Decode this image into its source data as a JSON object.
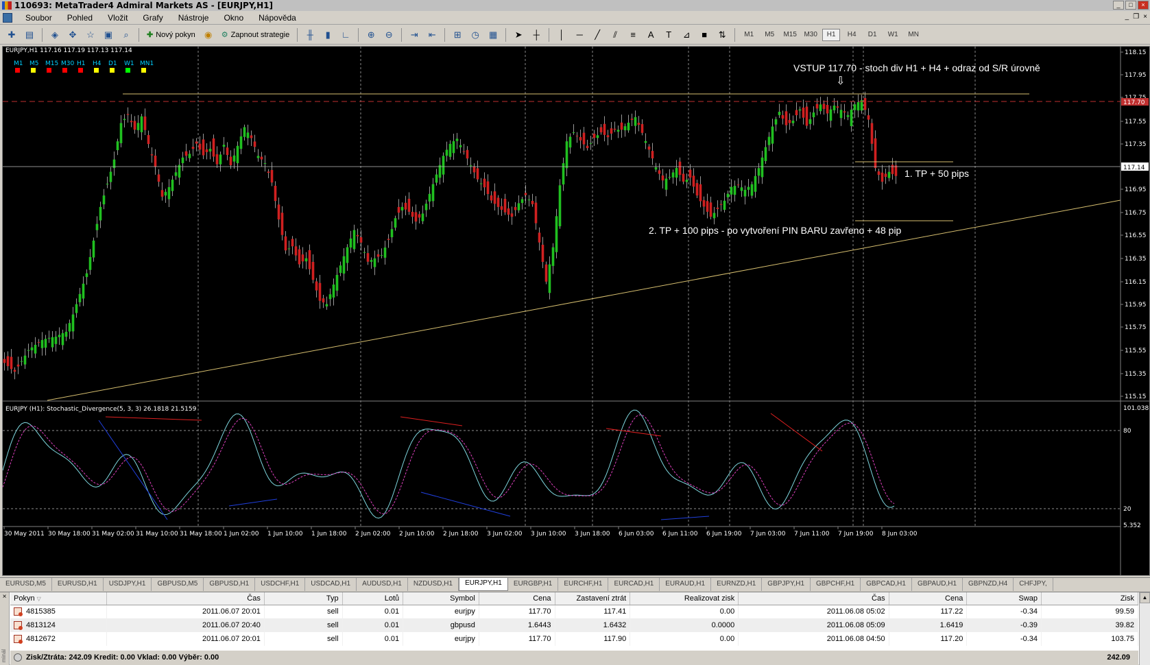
{
  "window": {
    "title": "110693: MetaTrader4 Admiral Markets AS - [EURJPY,H1]"
  },
  "menu": [
    "Soubor",
    "Pohled",
    "Vložit",
    "Grafy",
    "Nástroje",
    "Okno",
    "Nápověda"
  ],
  "toolbar": {
    "new_order_label": "Nový pokyn",
    "strategy_label": "Zapnout strategie",
    "timeframes": [
      "M1",
      "M5",
      "M15",
      "M30",
      "H1",
      "H4",
      "D1",
      "W1",
      "MN"
    ],
    "active_timeframe": "H1"
  },
  "chart": {
    "header": "EURJPY,H1  117.16 117.19 117.13 117.14",
    "mtf_labels": [
      "M1",
      "M5",
      "M15",
      "M30",
      "H1",
      "H4",
      "D1",
      "W1",
      "MN1"
    ],
    "mtf_colors": [
      "#ff0000",
      "#ffff00",
      "#ff0000",
      "#ff0000",
      "#ff0000",
      "#ffff00",
      "#ffff00",
      "#00ff00",
      "#ffff00"
    ],
    "price_labels": [
      "118.15",
      "117.95",
      "117.75",
      "117.70",
      "117.55",
      "117.35",
      "117.14",
      "116.95",
      "116.75",
      "116.55",
      "116.35",
      "116.15",
      "115.95",
      "115.75",
      "115.55",
      "115.35",
      "115.15"
    ],
    "current_price": "117.14",
    "entry_price": "117.70",
    "annotations": {
      "entry": "VSTUP 117.70 - stoch div H1 + H4 + odraz od S/R úrovně",
      "tp1": "1. TP  + 50 pips",
      "tp2": "2. TP + 100 pips - po vytvoření PIN BARU zavřeno + 48 pip"
    },
    "indicator_header": "EURJPY (H1):  Stochastic_Divergence(5, 3, 3) 26.1818 21.5159",
    "indicator_scale": [
      "101.0381",
      "80",
      "20",
      "5.352"
    ],
    "time_labels": [
      "30 May 2011",
      "30 May 18:00",
      "31 May 02:00",
      "31 May 10:00",
      "31 May 18:00",
      "1 Jun 02:00",
      "1 Jun 10:00",
      "1 Jun 18:00",
      "2 Jun 02:00",
      "2 Jun 10:00",
      "2 Jun 18:00",
      "3 Jun 02:00",
      "3 Jun 10:00",
      "3 Jun 18:00",
      "6 Jun 03:00",
      "6 Jun 11:00",
      "6 Jun 19:00",
      "7 Jun 03:00",
      "7 Jun 11:00",
      "7 Jun 19:00",
      "8 Jun 03:00"
    ]
  },
  "tabs": [
    "EURUSD,M5",
    "EURUSD,H1",
    "USDJPY,H1",
    "GBPUSD,M5",
    "GBPUSD,H1",
    "USDCHF,H1",
    "USDCAD,H1",
    "AUDUSD,H1",
    "NZDUSD,H1",
    "EURJPY,H1",
    "EURGBP,H1",
    "EURCHF,H1",
    "EURCAD,H1",
    "EURAUD,H1",
    "EURNZD,H1",
    "GBPJPY,H1",
    "GBPCHF,H1",
    "GBPCAD,H1",
    "GBPAUD,H1",
    "GBPNZD,H4",
    "CHFJPY,"
  ],
  "active_tab": "EURJPY,H1",
  "terminal": {
    "side_label": "minál",
    "columns": [
      "Pokyn",
      "Čas",
      "Typ",
      "Lotů",
      "Symbol",
      "Cena",
      "Zastavení ztrát",
      "Realizovat zisk",
      "Čas",
      "Cena",
      "Swap",
      "Zisk"
    ],
    "rows": [
      [
        "4815385",
        "2011.06.07 20:01",
        "sell",
        "0.01",
        "eurjpy",
        "117.70",
        "117.41",
        "0.00",
        "2011.06.08 05:02",
        "117.22",
        "-0.34",
        "99.59"
      ],
      [
        "4813124",
        "2011.06.07 20:40",
        "sell",
        "0.01",
        "gbpusd",
        "1.6443",
        "1.6432",
        "0.0000",
        "2011.06.08 05:09",
        "1.6419",
        "-0.39",
        "39.82"
      ],
      [
        "4812672",
        "2011.06.07 20:01",
        "sell",
        "0.01",
        "eurjpy",
        "117.70",
        "117.90",
        "0.00",
        "2011.06.08 04:50",
        "117.20",
        "-0.34",
        "103.75"
      ]
    ],
    "summary": "Zisk/Ztráta: 242.09  Kredit: 0.00  Vklad: 0.00  Výběr: 0.00",
    "summary_total": "242.09"
  }
}
